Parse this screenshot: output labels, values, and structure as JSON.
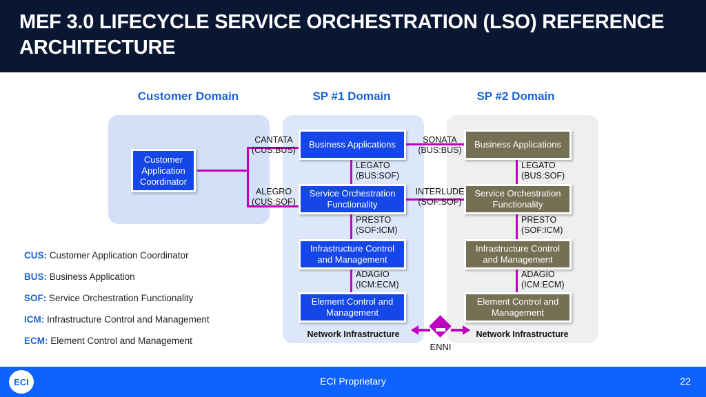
{
  "header": {
    "title": "MEF 3.0 Lifecycle Service Orchestration (LSO) Reference Architecture"
  },
  "domains": {
    "customer": {
      "heading": "Customer Domain"
    },
    "sp1": {
      "heading": "SP #1 Domain",
      "network_label": "Network Infrastructure"
    },
    "sp2": {
      "heading": "SP #2 Domain",
      "network_label": "Network Infrastructure"
    }
  },
  "blocks": {
    "customer_application_coordinator": "Customer Application Coordinator",
    "business_applications": "Business Applications",
    "service_orchestration_functionality": "Service Orchestration Functionality",
    "infrastructure_control_and_management": "Infrastructure Control and Management",
    "element_control_and_management": "Element Control and Management"
  },
  "interfaces": {
    "cantata": {
      "name": "CANTATA",
      "pair": "(CUS:BUS)"
    },
    "alegro": {
      "name": "ALEGRO",
      "pair": "(CUS:SOF)"
    },
    "sonata": {
      "name": "SONATA",
      "pair": "(BUS:BUS)"
    },
    "interlude": {
      "name": "INTERLUDE",
      "pair": "(SOF:SOF)"
    },
    "legato": {
      "name": "LEGATO",
      "pair": "(BUS:SOF)"
    },
    "presto": {
      "name": "PRESTO",
      "pair": "(SOF:ICM)"
    },
    "adagio": {
      "name": "ADAGIO",
      "pair": "(ICM:ECM)"
    },
    "enni": {
      "name": "ENNI"
    }
  },
  "legend": [
    {
      "abbr": "CUS:",
      "desc": "Customer Application Coordinator"
    },
    {
      "abbr": "BUS:",
      "desc": "Business Application"
    },
    {
      "abbr": "SOF:",
      "desc": "Service Orchestration Functionality"
    },
    {
      "abbr": "ICM:",
      "desc": "Infrastructure Control and Management"
    },
    {
      "abbr": "ECM:",
      "desc": "Element Control and Management"
    }
  ],
  "footer": {
    "logo": "ECI",
    "text": "ECI Proprietary",
    "page": "22"
  },
  "colors": {
    "header_bg": "#0a1733",
    "heading_blue": "#1a62d6",
    "block_blue": "#1546e8",
    "block_olive": "#756f53",
    "connector_magenta": "#bf00bf",
    "customer_domain_bg": "#d3e0f7",
    "sp1_domain_bg": "#dce8f9",
    "sp2_domain_bg": "#efefef",
    "footer_bg": "#0f62ff"
  }
}
